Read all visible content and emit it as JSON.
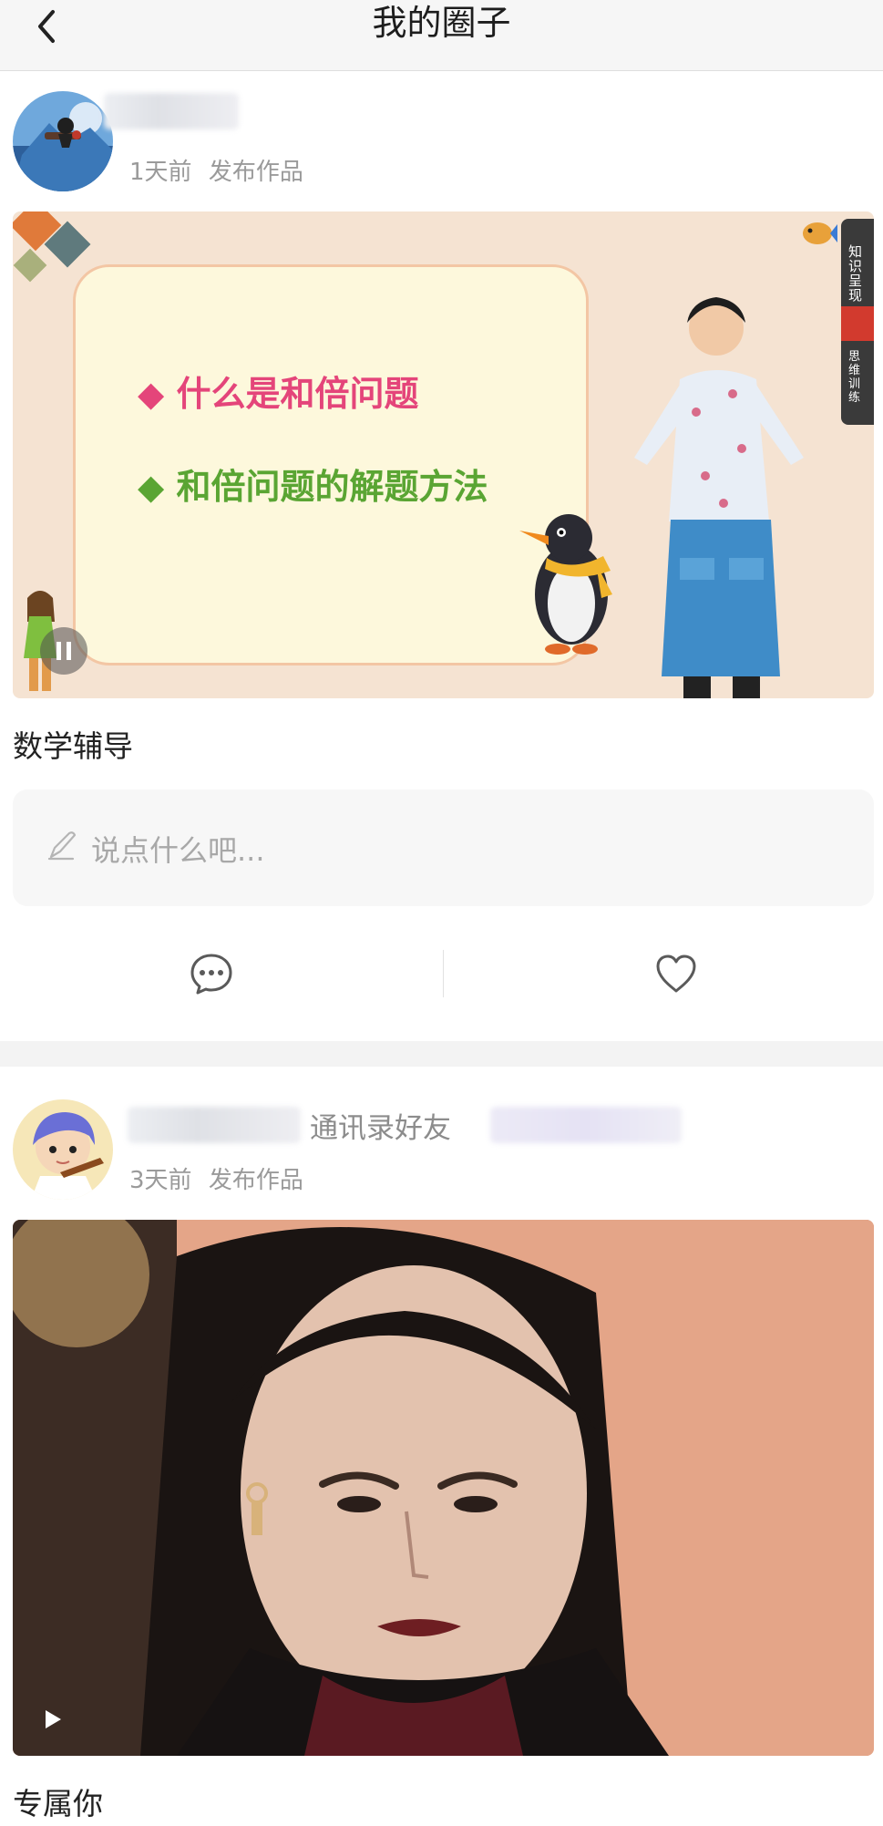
{
  "header": {
    "title": "我的圈子",
    "back_icon": "chevron-left-icon"
  },
  "posts": [
    {
      "time": "1天前",
      "action": "发布作品",
      "slide": {
        "bullet_1": "什么是和倍问题",
        "bullet_2": "和倍问题的解题方法",
        "side_tab_1": "知识呈现",
        "side_tab_2": "思维训练"
      },
      "media_control": "pause-icon",
      "caption": "数学辅导"
    },
    {
      "relation": "通讯录好友",
      "time": "3天前",
      "action": "发布作品",
      "media_control": "play-icon",
      "caption": "专属你"
    }
  ],
  "comment": {
    "placeholder": "说点什么吧...",
    "icon": "pen-icon"
  },
  "actions": {
    "comment_icon": "comment-bubble-icon",
    "like_icon": "heart-icon"
  },
  "colors": {
    "header_bg": "#f6f6f6",
    "bullet_pink": "#e4457a",
    "bullet_green": "#5aa533",
    "slide_bg": "#f5e3d2",
    "slide_card": "#fdf8dc",
    "meta_gray": "#9a9a9a"
  }
}
